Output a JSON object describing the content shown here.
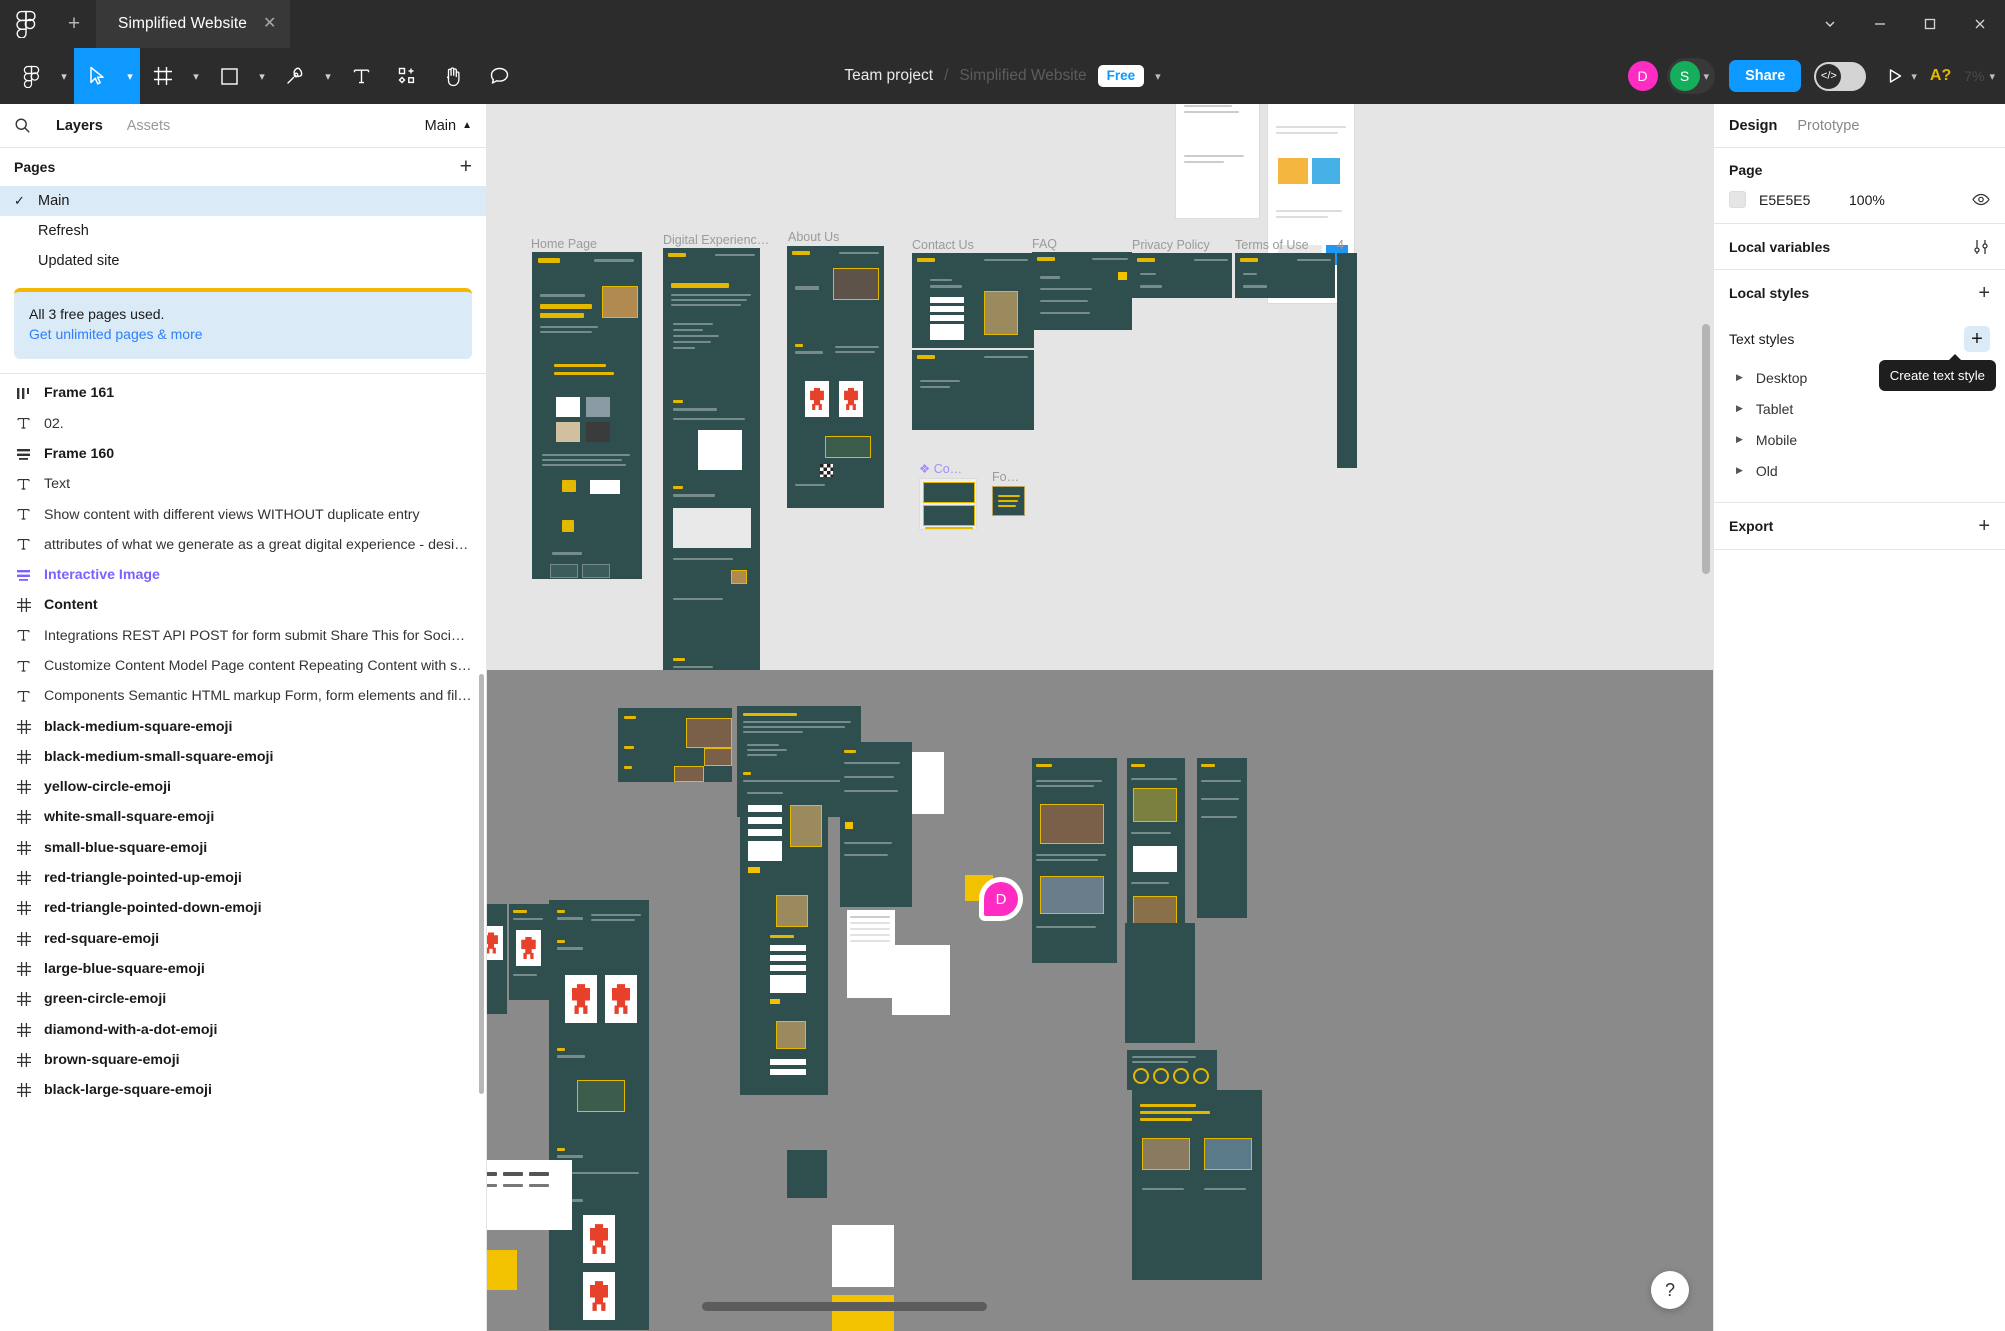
{
  "titlebar": {
    "tab_title": "Simplified Website",
    "close_icon": "close-icon",
    "new_tab_icon": "plus-icon",
    "logo_icon": "figma-logo-icon",
    "minimize_icon": "minimize-icon",
    "maximize_icon": "maximize-icon",
    "window_close_icon": "close-icon",
    "chevron_icon": "chevron-down-icon"
  },
  "toolbar": {
    "main_menu_icon": "figma-menu-icon",
    "move_tool_icon": "cursor-arrow-icon",
    "frame_tool_icon": "frame-icon",
    "shape_tool_icon": "square-icon",
    "pen_tool_icon": "pen-icon",
    "text_tool_icon": "text-icon",
    "actions_icon": "actions-sparkle-icon",
    "hand_tool_icon": "hand-icon",
    "comment_tool_icon": "comment-icon",
    "project_name": "Team project",
    "separator": "/",
    "file_name": "Simplified Website",
    "plan_badge": "Free",
    "avatars": [
      {
        "initial": "D",
        "color": "#ff2bc2"
      },
      {
        "initial": "S",
        "color": "#14ae5c"
      }
    ],
    "share_label": "Share",
    "dev_mode_icon": "code-brackets-icon",
    "present_icon": "play-icon",
    "warning_icon": "warning-A-icon",
    "warning_label": "A?",
    "zoom_value": "7%"
  },
  "left_panel": {
    "search_icon": "search-icon",
    "tabs": [
      {
        "label": "Layers",
        "active": true
      },
      {
        "label": "Assets",
        "active": false
      }
    ],
    "page_selector": "Main",
    "page_selector_icon": "chevron-up-icon",
    "pages_header": "Pages",
    "pages_add_icon": "plus-icon",
    "pages": [
      {
        "label": "Main",
        "selected": true,
        "check_icon": "check-icon"
      },
      {
        "label": "Refresh",
        "selected": false
      },
      {
        "label": "Updated site",
        "selected": false
      }
    ],
    "upsell_line1": "All 3 free pages used.",
    "upsell_line2": "Get unlimited pages & more",
    "layers": [
      {
        "name": "Frame 161",
        "icon": "auto-layout-horizontal-icon",
        "style": "bold"
      },
      {
        "name": "02.",
        "icon": "text-icon",
        "style": "normal"
      },
      {
        "name": "Frame 160",
        "icon": "auto-layout-vertical-icon",
        "style": "bold"
      },
      {
        "name": "Text",
        "icon": "text-icon",
        "style": "normal"
      },
      {
        "name": "Show content with different views WITHOUT duplicate entry",
        "icon": "text-icon",
        "style": "normal"
      },
      {
        "name": "attributes of what we generate as a great digital experience - desi…",
        "icon": "text-icon",
        "style": "normal"
      },
      {
        "name": "Interactive Image",
        "icon": "auto-layout-vertical-icon",
        "style": "component"
      },
      {
        "name": "Content",
        "icon": "component-icon",
        "style": "bold"
      },
      {
        "name": "Integrations REST API POST for form submit Share This for Social…",
        "icon": "text-icon",
        "style": "normal"
      },
      {
        "name": "Customize Content Model Page content Repeating Content with s…",
        "icon": "text-icon",
        "style": "normal"
      },
      {
        "name": "Components Semantic HTML markup Form, form elements and fil…",
        "icon": "text-icon",
        "style": "normal"
      },
      {
        "name": "black-medium-square-emoji",
        "icon": "component-icon",
        "style": "bold"
      },
      {
        "name": "black-medium-small-square-emoji",
        "icon": "component-icon",
        "style": "bold"
      },
      {
        "name": "yellow-circle-emoji",
        "icon": "component-icon",
        "style": "bold"
      },
      {
        "name": "white-small-square-emoji",
        "icon": "component-icon",
        "style": "bold"
      },
      {
        "name": "small-blue-square-emoji",
        "icon": "component-icon",
        "style": "bold"
      },
      {
        "name": "red-triangle-pointed-up-emoji",
        "icon": "component-icon",
        "style": "bold"
      },
      {
        "name": "red-triangle-pointed-down-emoji",
        "icon": "component-icon",
        "style": "bold"
      },
      {
        "name": "red-square-emoji",
        "icon": "component-icon",
        "style": "bold"
      },
      {
        "name": "large-blue-square-emoji",
        "icon": "component-icon",
        "style": "bold"
      },
      {
        "name": "green-circle-emoji",
        "icon": "component-icon",
        "style": "bold"
      },
      {
        "name": "diamond-with-a-dot-emoji",
        "icon": "component-icon",
        "style": "bold"
      },
      {
        "name": "brown-square-emoji",
        "icon": "component-icon",
        "style": "bold"
      },
      {
        "name": "black-large-square-emoji",
        "icon": "component-icon",
        "style": "bold"
      }
    ]
  },
  "right_panel": {
    "tabs": [
      {
        "label": "Design",
        "active": true
      },
      {
        "label": "Prototype",
        "active": false
      }
    ],
    "page_section_title": "Page",
    "page_color_hex": "E5E5E5",
    "page_opacity": "100%",
    "visibility_icon": "eye-icon",
    "local_variables_title": "Local variables",
    "local_variables_icon": "sliders-icon",
    "local_styles_title": "Local styles",
    "local_styles_add_icon": "plus-icon",
    "text_styles_title": "Text styles",
    "text_styles_add_icon": "plus-icon",
    "text_style_groups": [
      {
        "label": "Desktop",
        "icon": "triangle-right-icon"
      },
      {
        "label": "Tablet",
        "icon": "triangle-right-icon"
      },
      {
        "label": "Mobile",
        "icon": "triangle-right-icon"
      },
      {
        "label": "Old",
        "icon": "triangle-right-icon"
      }
    ],
    "tooltip_text": "Create text style",
    "export_title": "Export",
    "export_add_icon": "plus-icon"
  },
  "canvas": {
    "frames": [
      {
        "label": "Home Page"
      },
      {
        "label": "Digital Experienc…"
      },
      {
        "label": "About Us"
      },
      {
        "label": "Contact Us"
      },
      {
        "label": "FAQ"
      },
      {
        "label": "Privacy Policy"
      },
      {
        "label": "Terms of Use"
      },
      {
        "label": "4"
      },
      {
        "label": "Co…",
        "component": true
      },
      {
        "label": "Fo…"
      }
    ],
    "cursor_initial": "D",
    "help_icon": "question-mark-icon",
    "page_bg_color": "#E5E5E5",
    "frame_fill_color": "#2F4F4F",
    "accent_color": "#E5B800"
  }
}
